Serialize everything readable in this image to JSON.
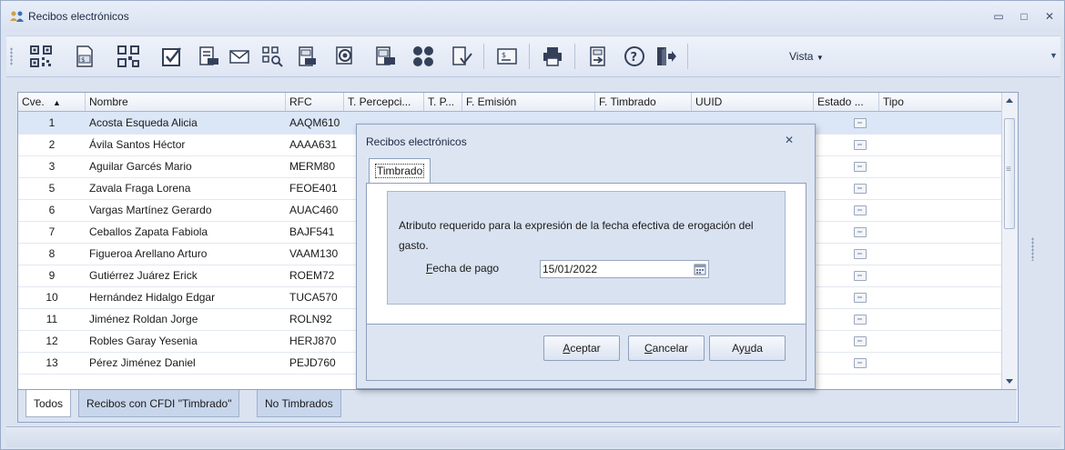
{
  "window": {
    "title": "Recibos electrónicos"
  },
  "toolbar": {
    "vista_label": "Vista",
    "icons": [
      "qr-code-icon",
      "invoice-money-icon",
      "qr-code-2-icon",
      "checkbox-icon",
      "printer-doc-icon",
      "mail-icon",
      "search-qr-icon",
      "doc-money-icon",
      "stamp-icon",
      "doc-money-2-icon",
      "group-icon",
      "doc-check-icon",
      "money-card-icon",
      "printer-icon",
      "export-doc-icon",
      "help-icon",
      "exit-icon"
    ]
  },
  "grid": {
    "columns": [
      "Cve.",
      "Nombre",
      "RFC",
      "T. Percepci...",
      "T. P...",
      "F. Emisión",
      "F. Timbrado",
      "UUID",
      "Estado ...",
      "Tipo"
    ],
    "rows": [
      {
        "cve": "1",
        "nombre": "Acosta Esqueda Alicia",
        "rfc": "AAQM610"
      },
      {
        "cve": "2",
        "nombre": "Ávila Santos Héctor",
        "rfc": "AAAA631"
      },
      {
        "cve": "3",
        "nombre": "Aguilar Garcés Mario",
        "rfc": "MERM80"
      },
      {
        "cve": "5",
        "nombre": "Zavala Fraga Lorena",
        "rfc": "FEOE401"
      },
      {
        "cve": "6",
        "nombre": "Vargas Martínez Gerardo",
        "rfc": "AUAC460"
      },
      {
        "cve": "7",
        "nombre": "Ceballos Zapata Fabiola",
        "rfc": "BAJF541"
      },
      {
        "cve": "8",
        "nombre": "Figueroa Arellano Arturo",
        "rfc": "VAAM130"
      },
      {
        "cve": "9",
        "nombre": "Gutiérrez Juárez Erick",
        "rfc": "ROEM72"
      },
      {
        "cve": "10",
        "nombre": "Hernández Hidalgo Edgar",
        "rfc": "TUCA570"
      },
      {
        "cve": "11",
        "nombre": "Jiménez Roldan Jorge",
        "rfc": "ROLN92"
      },
      {
        "cve": "12",
        "nombre": "Robles Garay Yesenia",
        "rfc": "HERJ870"
      },
      {
        "cve": "13",
        "nombre": "Pérez Jiménez Daniel",
        "rfc": "PEJD760"
      }
    ]
  },
  "tabs": [
    "Todos",
    "Recibos con CFDI \"Timbrado\"",
    "No Timbrados"
  ],
  "dialog": {
    "title": "Recibos electrónicos",
    "tab": "Timbrado",
    "message": "Atributo requerido para la expresión de la fecha efectiva de erogación del gasto.",
    "field_label_first": "F",
    "field_label_rest": "echa de pago",
    "date_value": "15/01/2022",
    "buttons": {
      "accept_u": "A",
      "accept_rest": "ceptar",
      "cancel_u": "C",
      "cancel_rest": "ancelar",
      "help_pre": "Ay",
      "help_u": "u",
      "help_rest": "da"
    }
  }
}
